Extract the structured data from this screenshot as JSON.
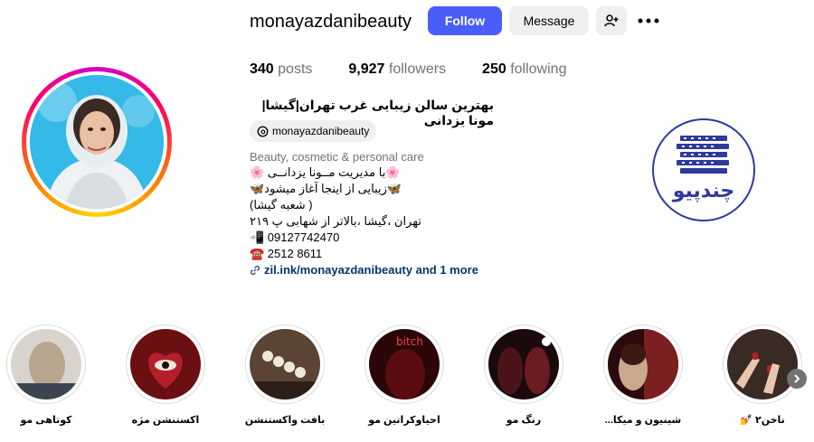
{
  "profile": {
    "username": "monayazdanibeauty",
    "follow_label": "Follow",
    "message_label": "Message",
    "posts_count": "340",
    "posts_label": "posts",
    "followers_count": "9,927",
    "followers_label": "followers",
    "following_count": "250",
    "following_label": "following"
  },
  "bio": {
    "name": "بهترین سالن زیبایی غرب تهران|گیشا|مونا یزدانی",
    "threads_handle": "monayazdanibeauty",
    "category": "Beauty, cosmetic & personal care",
    "lines": [
      "🌸با مدیریت مــونا یزدانــی 🌸",
      "🦋زیبایی از اینجا آغاز میشود🦋",
      "( شعبه گیشا)",
      "تهران ،گیشا ،بالاتر از شهابی پ ۲۱۹",
      "📲 09127742470",
      "☎️ 2512 8611"
    ],
    "link_text": "zil.ink/monayazdanibeauty and 1 more"
  },
  "logo": {
    "text": "چندپیو"
  },
  "highlights": [
    {
      "label": "کوتاهی مو",
      "color": "#b8a58e"
    },
    {
      "label": "اکستنشن مژه",
      "color": "#8c1a1a"
    },
    {
      "label": "بافت واکستنشن",
      "color": "#6b5544"
    },
    {
      "label": "احیاوکراتین مو",
      "color": "#5a0c10"
    },
    {
      "label": "رنگ مو",
      "color": "#4a1418"
    },
    {
      "label": "شینیون و میکا...",
      "color": "#7a2020"
    },
    {
      "label": "ناخن۲ 💅",
      "color": "#3a2a24"
    }
  ],
  "colors": {
    "follow_bg": "#4a5df9",
    "link": "#00376b"
  }
}
